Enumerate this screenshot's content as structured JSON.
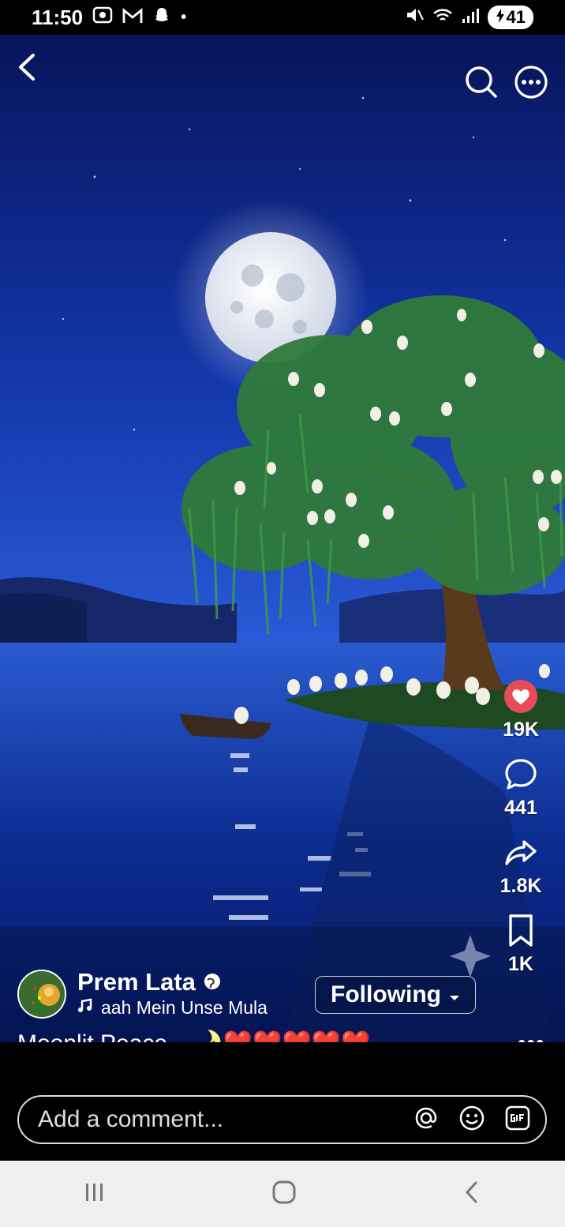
{
  "status": {
    "time": "11:50",
    "battery": "41"
  },
  "post": {
    "author": "Prem Lata",
    "music": "aah Mein Unse Mula",
    "follow_label": "Following",
    "caption": "Moonlit Peace...",
    "caption_emojis": "🌛❤️❤️❤️❤️❤️...",
    "more": "•••"
  },
  "actions": {
    "likes": "19K",
    "comments": "441",
    "shares": "1.8K",
    "saves": "1K"
  },
  "comment": {
    "placeholder": "Add a comment..."
  },
  "colors": {
    "like_accent": "#e94c59",
    "sky_top": "#0a1a6b",
    "water": "#0a2c8e"
  }
}
